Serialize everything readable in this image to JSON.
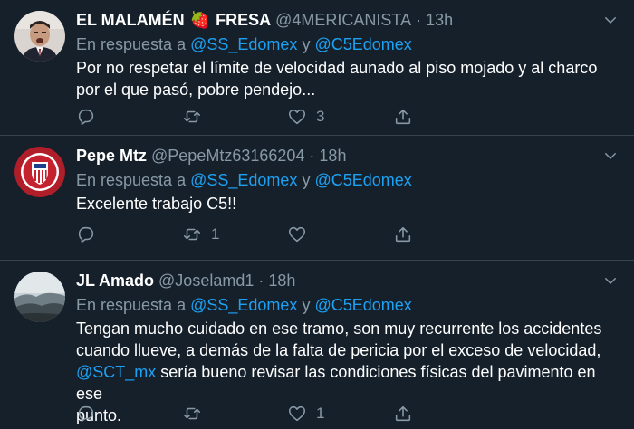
{
  "tweets": [
    {
      "name": "EL MALAMÉN",
      "emoji": "🍓",
      "name_suffix": "FRESA",
      "handle": "@4MERICANISTA",
      "time": "13h",
      "reply_prefix": "En respuesta a",
      "reply_mention1": "@SS_Edomex",
      "reply_and": "y",
      "reply_mention2": "@C5Edomex",
      "text_line1": "Por no respetar el límite de velocidad aunado al piso mojado y al charco",
      "text_line2": "por el que pasó, pobre pendejo...",
      "reply_count": "",
      "retweet_count": "",
      "like_count": "3"
    },
    {
      "name": "Pepe Mtz",
      "handle": "@PepeMtz63166204",
      "time": "18h",
      "reply_prefix": "En respuesta a",
      "reply_mention1": "@SS_Edomex",
      "reply_and": "y",
      "reply_mention2": "@C5Edomex",
      "text": "Excelente trabajo C5!!",
      "reply_count": "",
      "retweet_count": "1",
      "like_count": ""
    },
    {
      "name": "JL Amado",
      "handle": "@Joselamd1",
      "time": "18h",
      "reply_prefix": "En respuesta a",
      "reply_mention1": "@SS_Edomex",
      "reply_and": "y",
      "reply_mention2": "@C5Edomex",
      "text_line1": "Tengan mucho cuidado en ese tramo, son muy recurrente los accidentes",
      "text_line2": "cuando llueve, a demás de la falta de pericia por el exceso de velocidad,",
      "text_line3_mention": "@SCT_mx",
      "text_line3_rest": " sería bueno revisar las condiciones físicas del pavimento en ese",
      "text_line4": "punto.",
      "reply_count": "",
      "retweet_count": "",
      "like_count": "1"
    }
  ],
  "colors": {
    "background": "#15202b",
    "secondary_text": "#8899a6",
    "link": "#1da1f2",
    "divider": "#38444d"
  }
}
